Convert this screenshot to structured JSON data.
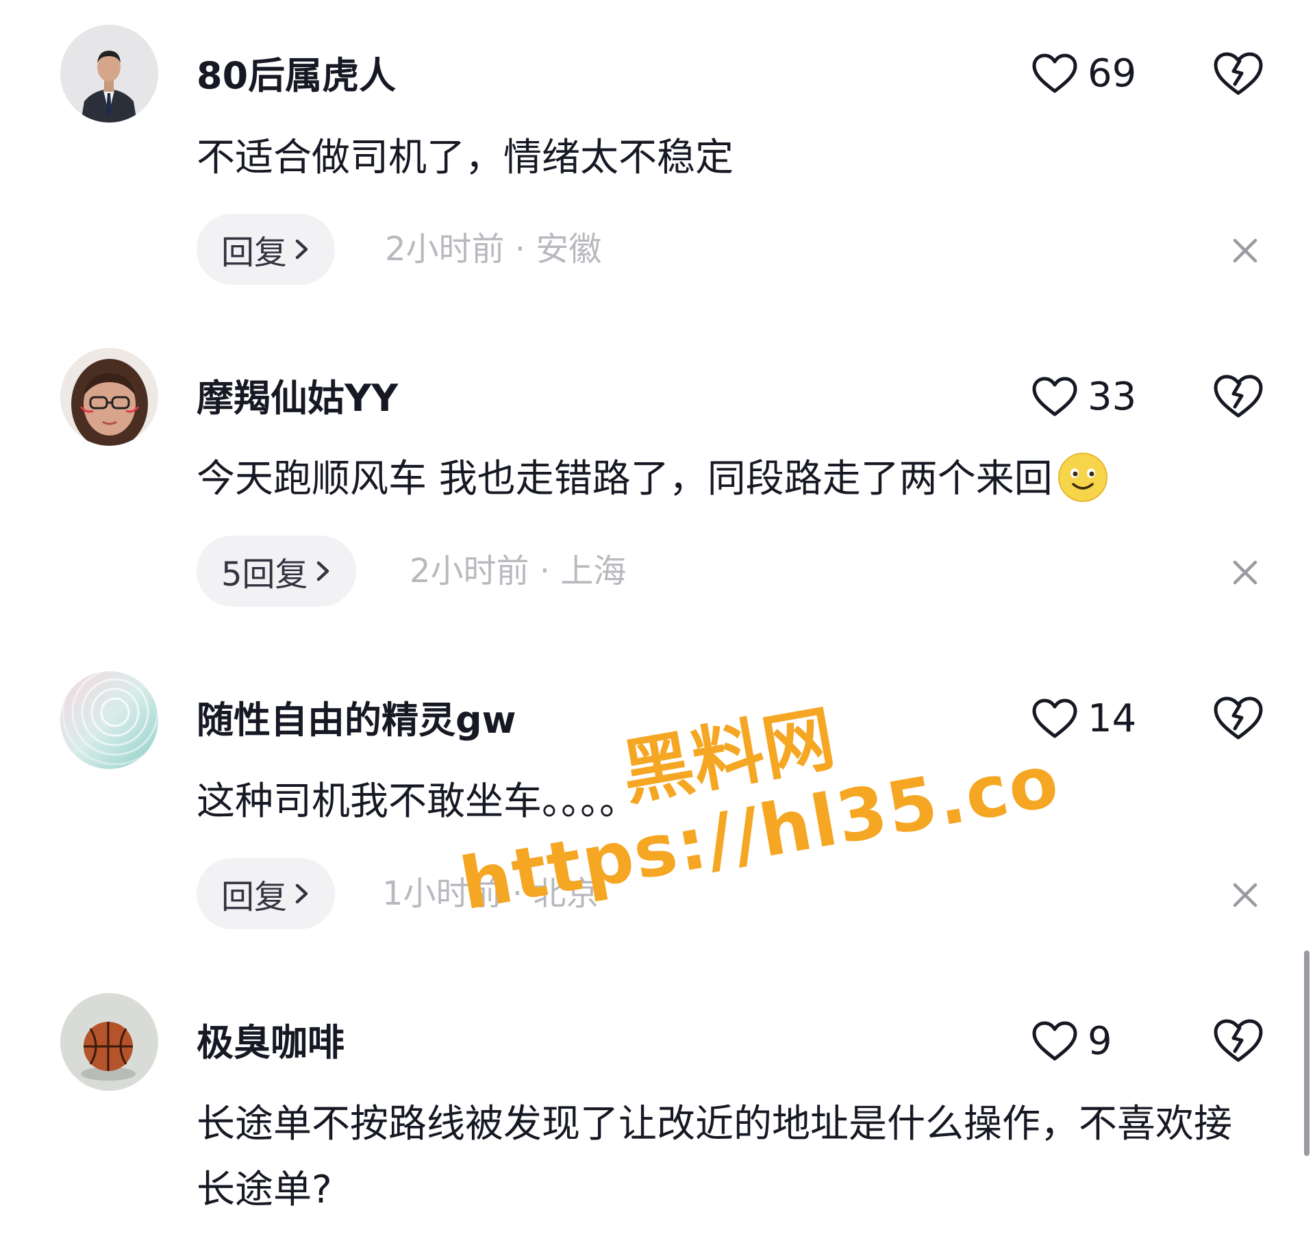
{
  "comments": [
    {
      "username": "80后属虎人",
      "likes": "69",
      "text": "不适合做司机了，情绪太不稳定",
      "reply_label": "回复",
      "meta": "2小时前 · 安徽",
      "avatar_icon": "avatar-man-in-suit"
    },
    {
      "username": "摩羯仙姑YY",
      "likes": "33",
      "text": "今天跑顺风车 我也走错路了，同段路走了两个来回",
      "emoji": "smiling-face-emoji",
      "reply_label": "5回复",
      "meta": "2小时前 · 上海",
      "avatar_icon": "avatar-woman-with-glasses"
    },
    {
      "username": "随性自由的精灵gw",
      "likes": "14",
      "text": "这种司机我不敢坐车。。。。",
      "reply_label": "回复",
      "meta": "1小时前 · 北京",
      "avatar_icon": "avatar-pastel-swirl"
    },
    {
      "username": "极臭咖啡",
      "likes": "9",
      "text": "长途单不按路线被发现了让改近的地址是什么操作，不喜欢接长途单?",
      "avatar_icon": "avatar-basketball"
    }
  ],
  "icons": {
    "like": "heart-outline-icon",
    "dislike": "broken-heart-icon",
    "close": "close-x-icon",
    "reply_chevron": "chevron-right-icon"
  },
  "watermark": {
    "line1": "黑料网",
    "line2": "https://hl35.co"
  },
  "colors": {
    "text": "#161823",
    "meta": "#b8b9be",
    "reply_bg": "#f2f2f4",
    "watermark": "#f5a623"
  }
}
